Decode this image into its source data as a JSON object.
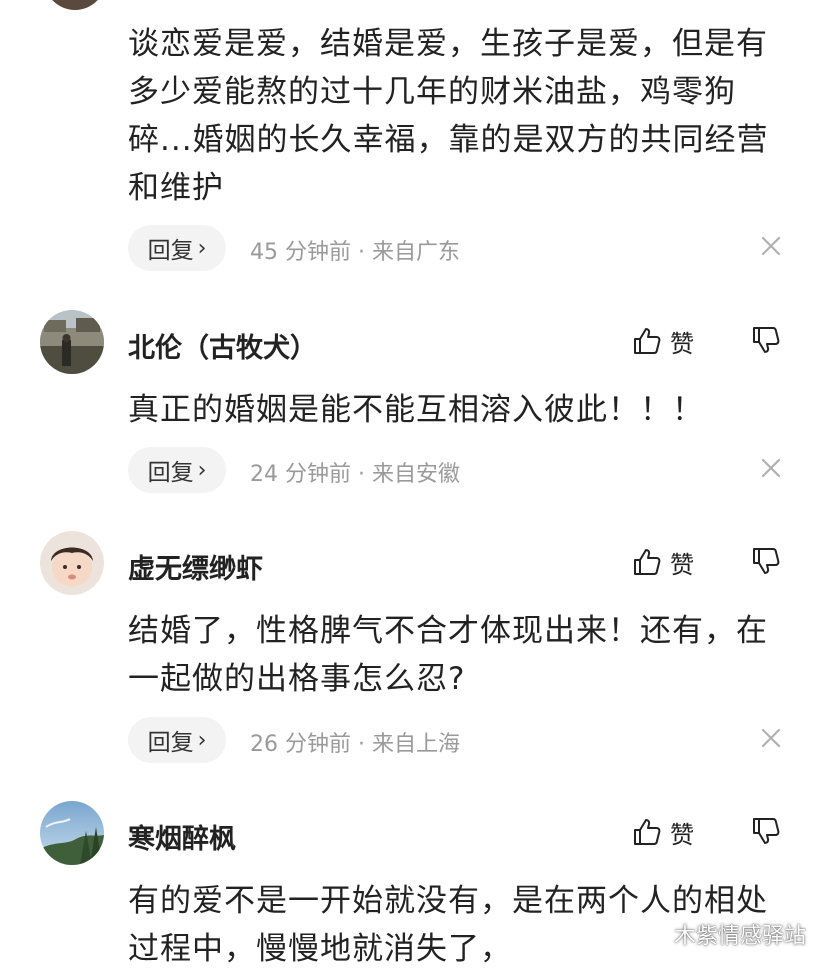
{
  "top_comment": {
    "text": "谈恋爱是爱，结婚是爱，生孩子是爱，但是有多少爱能熬的过十几年的财米油盐，鸡零狗碎...婚姻的长久幸福，靠的是双方的共同经营和维护",
    "reply_label": "回复",
    "meta": "45 分钟前 · 来自广东"
  },
  "comments": [
    {
      "username": "北伦（古牧犬）",
      "like_label": "赞",
      "text": "真正的婚姻是能不能互相溶入彼此！！！",
      "reply_label": "回复",
      "meta": "24 分钟前 · 来自安徽"
    },
    {
      "username": "虚无缥缈虾",
      "like_label": "赞",
      "text": "结婚了，性格脾气不合才体现出来！还有，在一起做的出格事怎么忍?",
      "reply_label": "回复",
      "meta": "26 分钟前 · 来自上海"
    },
    {
      "username": "寒烟醉枫",
      "like_label": "赞",
      "text": "有的爱不是一开始就没有，是在两个人的相处过程中，慢慢地就消失了，"
    }
  ],
  "watermark": {
    "text": "木紫情感驿站",
    "icon": "wechat-icon"
  },
  "icons": {
    "like": "thumbs-up-icon",
    "dislike": "thumbs-down-icon",
    "reply_chevron": "chevron-right-icon",
    "close": "close-icon"
  }
}
